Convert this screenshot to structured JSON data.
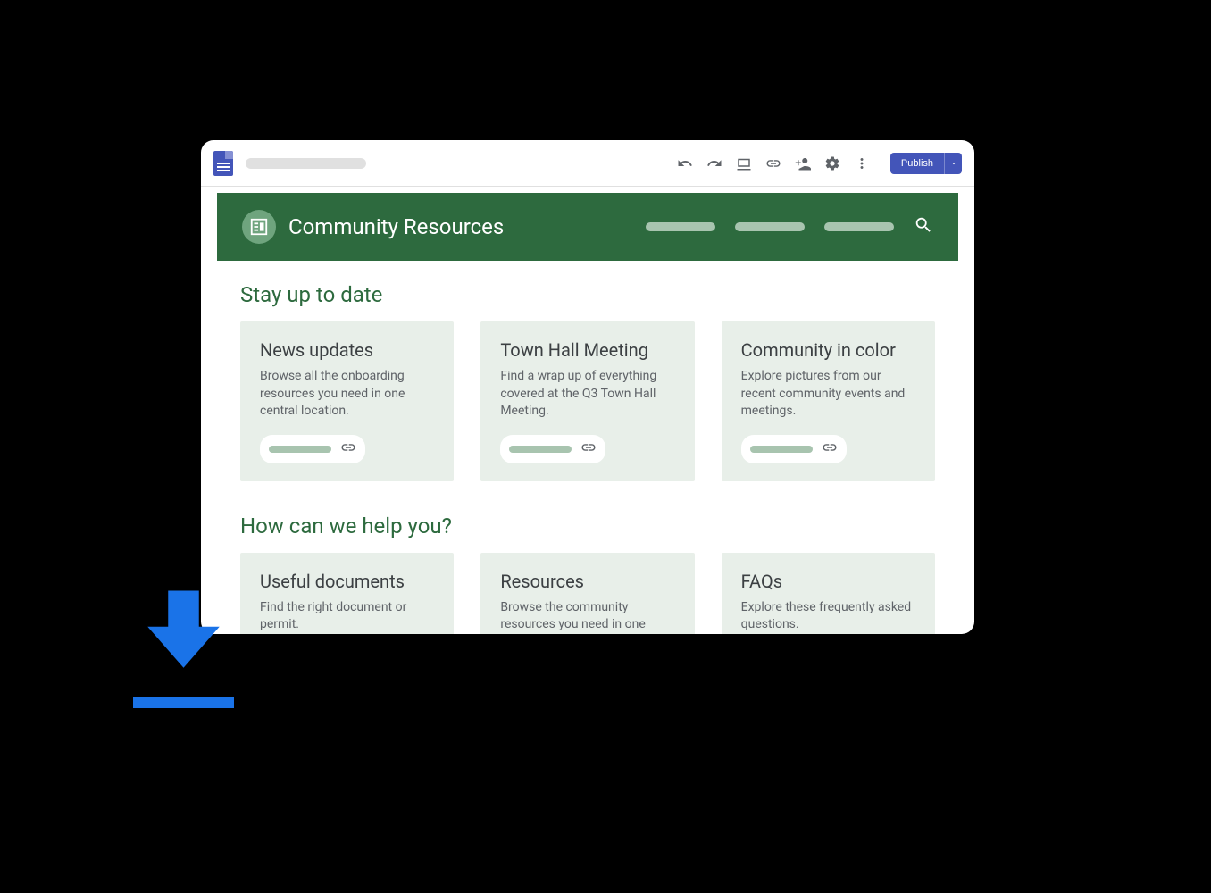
{
  "toolbar": {
    "publish_label": "Publish"
  },
  "site": {
    "title": "Community Resources"
  },
  "sections": [
    {
      "title": "Stay up to date",
      "cards": [
        {
          "title": "News updates",
          "desc": "Browse all the onboarding resources you need in one central location."
        },
        {
          "title": "Town Hall Meeting",
          "desc": "Find a wrap up of everything covered at the Q3 Town Hall Meeting."
        },
        {
          "title": "Community in color",
          "desc": "Explore pictures from our recent community events and meetings."
        }
      ]
    },
    {
      "title": "How can we help you?",
      "cards": [
        {
          "title": "Useful documents",
          "desc": "Find the right document or permit."
        },
        {
          "title": "Resources",
          "desc": "Browse the community resources you need in one central location."
        },
        {
          "title": "FAQs",
          "desc": "Explore these frequently asked questions."
        }
      ]
    }
  ]
}
